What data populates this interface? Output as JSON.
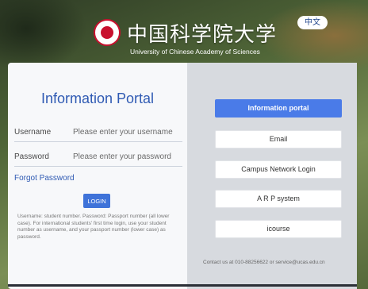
{
  "header": {
    "university_name_cn": "中国科学院大学",
    "university_name_en": "University of Chinese Academy of Sciences",
    "language_toggle": "中文"
  },
  "login": {
    "title": "Information Portal",
    "username_label": "Username",
    "username_placeholder": "Please enter your username",
    "password_label": "Password",
    "password_placeholder": "Please enter your password",
    "forgot_password": "Forgot Password",
    "login_button": "LOGIN",
    "help_text": "Username: student number. Password: Passport number (all lower case). For international students' first time login, use your student number as username, and your passport number (lower case) as password."
  },
  "menu": {
    "items": [
      {
        "label": "Information portal"
      },
      {
        "label": "Email"
      },
      {
        "label": "Campus Network Login"
      },
      {
        "label": "A R P system"
      },
      {
        "label": "icourse"
      }
    ]
  },
  "footer": {
    "contact": "Contact us at 010-88256622 or service@ucas.edu.cn"
  },
  "colors": {
    "accent": "#4a7be8",
    "title": "#2f5ab3",
    "emblem_red": "#c8102e"
  }
}
